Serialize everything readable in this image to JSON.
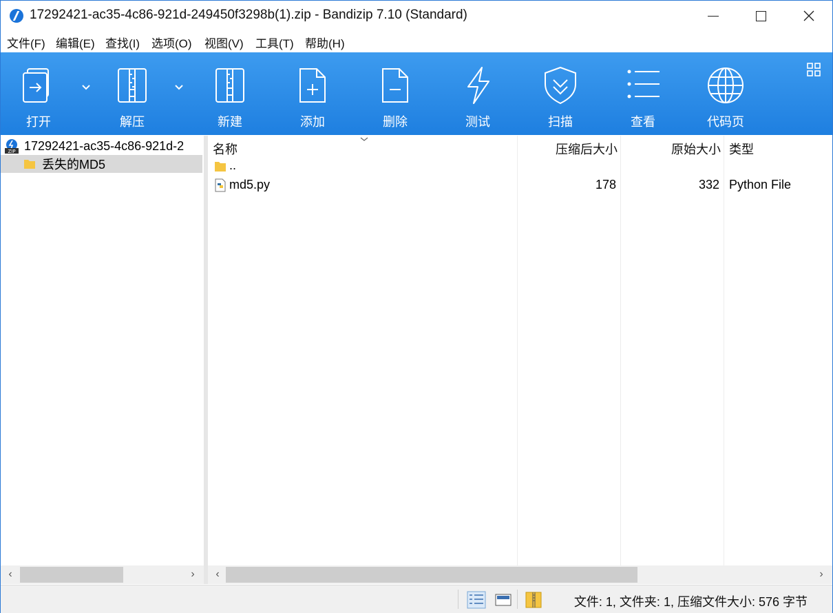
{
  "window": {
    "title": "17292421-ac35-4c86-921d-249450f3298b(1).zip - Bandizip 7.10 (Standard)"
  },
  "menu": {
    "items": [
      "文件(F)",
      "编辑(E)",
      "查找(I)",
      "选项(O)",
      "视图(V)",
      "工具(T)",
      "帮助(H)"
    ]
  },
  "toolbar": {
    "open": "打开",
    "extract": "解压",
    "new": "新建",
    "add": "添加",
    "delete": "删除",
    "test": "测试",
    "scan": "扫描",
    "view": "查看",
    "codepage": "代码页"
  },
  "tree": {
    "root": "17292421-ac35-4c86-921d-2",
    "child": "丢失的MD5"
  },
  "list": {
    "headers": {
      "name": "名称",
      "packed": "压缩后大小",
      "original": "原始大小",
      "type": "类型"
    },
    "rows": [
      {
        "name": "..",
        "packed": "",
        "original": "",
        "type": ""
      },
      {
        "name": "md5.py",
        "packed": "178",
        "original": "332",
        "type": "Python File"
      }
    ]
  },
  "status": {
    "text": "文件: 1, 文件夹: 1, 压缩文件大小: 576 字节"
  },
  "colors": {
    "toolbar": "#1e7fe0",
    "accent": "#2b79d6",
    "selection": "#d9d9d9"
  }
}
